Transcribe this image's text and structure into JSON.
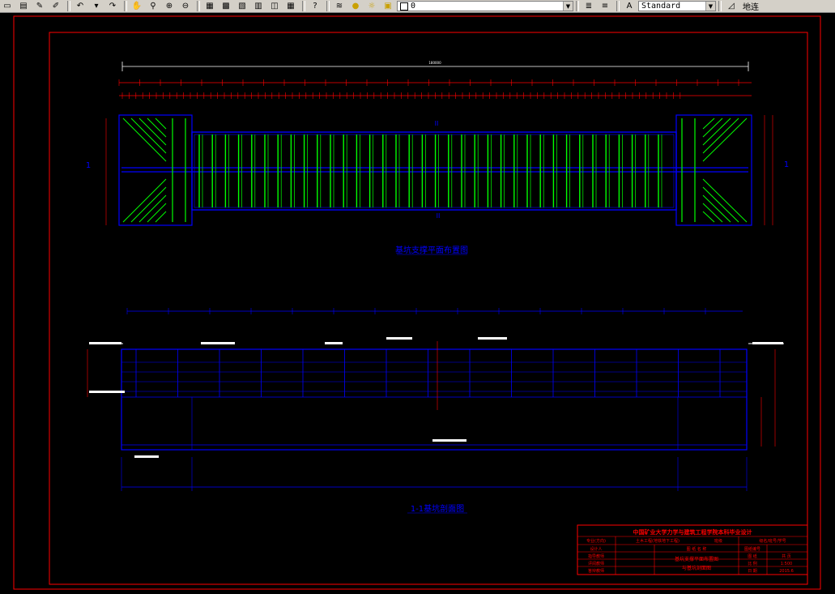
{
  "toolbar": {
    "layer_value": "0",
    "text_style_value": "Standard",
    "cut_label": "地连"
  },
  "drawing": {
    "plan_overall_dim": "180000",
    "plan_title": "基坑支撑平面布置图",
    "section_title": "1-1基坑剖面图",
    "section_marker_left": "1",
    "section_marker_right": "1",
    "mark_top": "II",
    "mark_bottom": "II"
  },
  "title_block": {
    "header": "中国矿业大学力学与建筑工程学院本科毕业设计",
    "rows": [
      [
        "专业(方向)",
        "土木工程(地铁地下工程)",
        "班级",
        "级名/班号/学号"
      ],
      [
        "设计人",
        "",
        "",
        "",
        "图纸编号",
        ""
      ],
      [
        "指导教师",
        "",
        "基坑支撑平面布置图",
        "",
        "图 纸",
        "共 页"
      ],
      [
        "评阅教师",
        "",
        "与基坑剖面图",
        "",
        "比 例",
        "1:500"
      ],
      [
        "答辩教师",
        "",
        "",
        "",
        "日 期",
        "2015.6"
      ]
    ],
    "project_label": "图 纸 名 称"
  },
  "colors": {
    "frame_red": "#ff0000",
    "drawing_blue": "#0000ff",
    "strut_green": "#00ff00",
    "label_white": "#ffffff"
  }
}
